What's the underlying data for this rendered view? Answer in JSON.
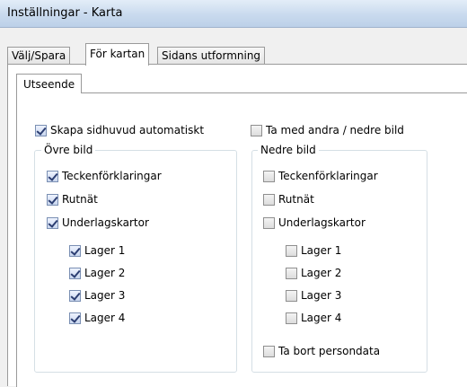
{
  "window": {
    "title": "Inställningar - Karta"
  },
  "tabs": [
    {
      "label": "Välj/Spara",
      "active": false
    },
    {
      "label": "För kartan",
      "active": true
    },
    {
      "label": "Sidans utformning",
      "active": false
    }
  ],
  "subtab": {
    "label": "Utseende"
  },
  "options": {
    "auto_header": {
      "label": "Skapa sidhuvud automatiskt",
      "checked": true
    },
    "include_lower": {
      "label": "Ta med andra / nedre bild",
      "checked": false
    }
  },
  "upper": {
    "legend": "Övre bild",
    "legends": {
      "label": "Teckenförklaringar",
      "checked": true
    },
    "grid": {
      "label": "Rutnät",
      "checked": true
    },
    "basemaps": {
      "label": "Underlagskartor",
      "checked": true
    },
    "layers": [
      {
        "label": "Lager 1",
        "checked": true
      },
      {
        "label": "Lager 2",
        "checked": true
      },
      {
        "label": "Lager 3",
        "checked": true
      },
      {
        "label": "Lager 4",
        "checked": true
      }
    ]
  },
  "lower": {
    "legend": "Nedre bild",
    "legends": {
      "label": "Teckenförklaringar",
      "checked": false
    },
    "grid": {
      "label": "Rutnät",
      "checked": false
    },
    "basemaps": {
      "label": "Underlagskartor",
      "checked": false
    },
    "layers": [
      {
        "label": "Lager 1",
        "checked": false
      },
      {
        "label": "Lager 2",
        "checked": false
      },
      {
        "label": "Lager 3",
        "checked": false
      },
      {
        "label": "Lager 4",
        "checked": false
      }
    ],
    "remove_personal": {
      "label": "Ta bort persondata",
      "checked": false
    }
  }
}
